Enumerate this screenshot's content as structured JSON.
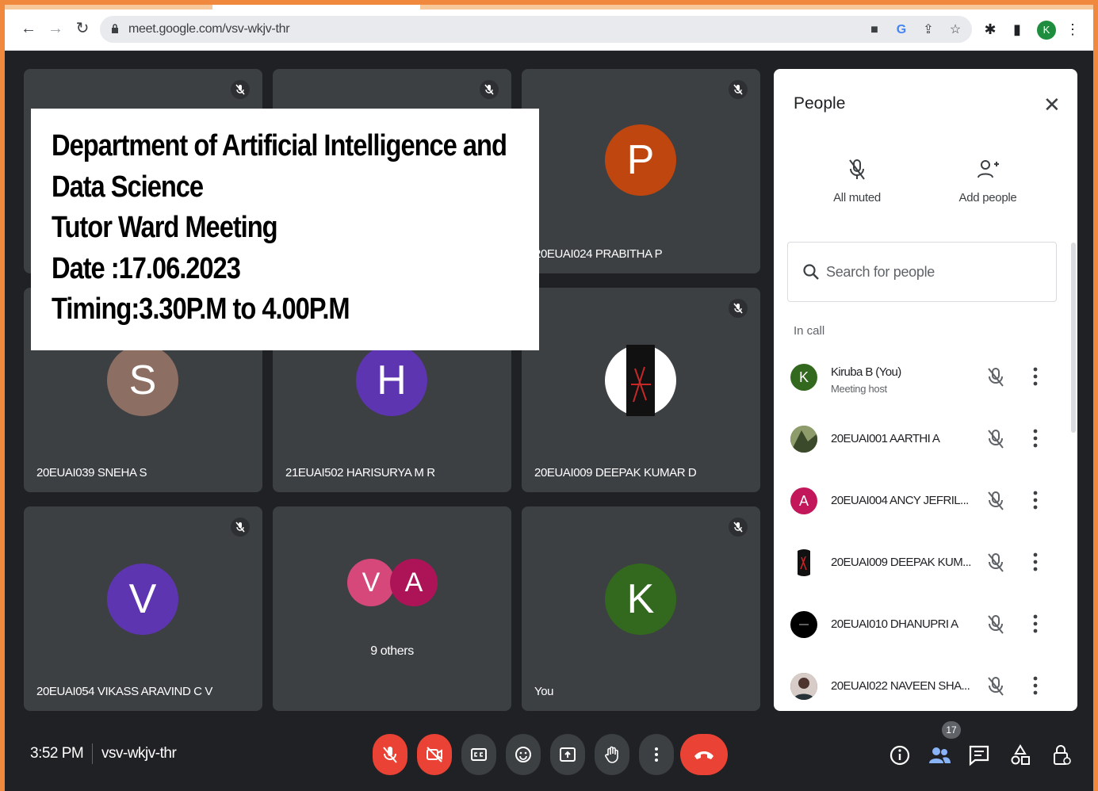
{
  "browser": {
    "url": "meet.google.com/vsv-wkjv-thr",
    "profile_initial": "K"
  },
  "banner": {
    "line1": "Department of Artificial Intelligence and",
    "line2": "Data Science",
    "line3": "Tutor Ward Meeting",
    "line4": "Date :17.06.2023",
    "line5": "Timing:3.30P.M to 4.00P.M"
  },
  "tiles": {
    "prabitha": {
      "initial": "P",
      "name": "20EUAI024 PRABITHA P",
      "color": "#c0460f"
    },
    "sneha": {
      "initial": "S",
      "name": "20EUAI039 SNEHA S",
      "color": "#8d6e63"
    },
    "harisurya": {
      "initial": "H",
      "name": "21EUAI502 HARISURYA M R",
      "color": "#5e35b1"
    },
    "deepak": {
      "name": "20EUAI009 DEEPAK KUMAR D"
    },
    "vikass": {
      "initial": "V",
      "name": "20EUAI054 VIKASS ARAVIND C V",
      "color": "#5e35b1"
    },
    "others": {
      "initial_a": "V",
      "initial_b": "A",
      "label": "9 others"
    },
    "you": {
      "initial": "K",
      "name": "You",
      "color": "#33691e"
    }
  },
  "people_panel": {
    "title": "People",
    "all_muted": "All muted",
    "add_people": "Add people",
    "search_placeholder": "Search for people",
    "section": "In call",
    "participants": [
      {
        "initial": "K",
        "name": "Kiruba B (You)",
        "sub": "Meeting host",
        "color": "#33691e"
      },
      {
        "initial": "",
        "name": "20EUAI001 AARTHI A",
        "color": "#556b2f"
      },
      {
        "initial": "A",
        "name": "20EUAI004 ANCY JEFRIL...",
        "color": "#c2185b"
      },
      {
        "initial": "",
        "name": "20EUAI009 DEEPAK KUM...",
        "color": "#111111"
      },
      {
        "initial": "",
        "name": "20EUAI010 DHANUPRI A",
        "color": "#000000"
      },
      {
        "initial": "",
        "name": "20EUAI022 NAVEEN SHA...",
        "color": "#4e342e"
      }
    ]
  },
  "bottom_bar": {
    "time": "3:52 PM",
    "meeting_code": "vsv-wkjv-thr",
    "participant_count": "17"
  }
}
